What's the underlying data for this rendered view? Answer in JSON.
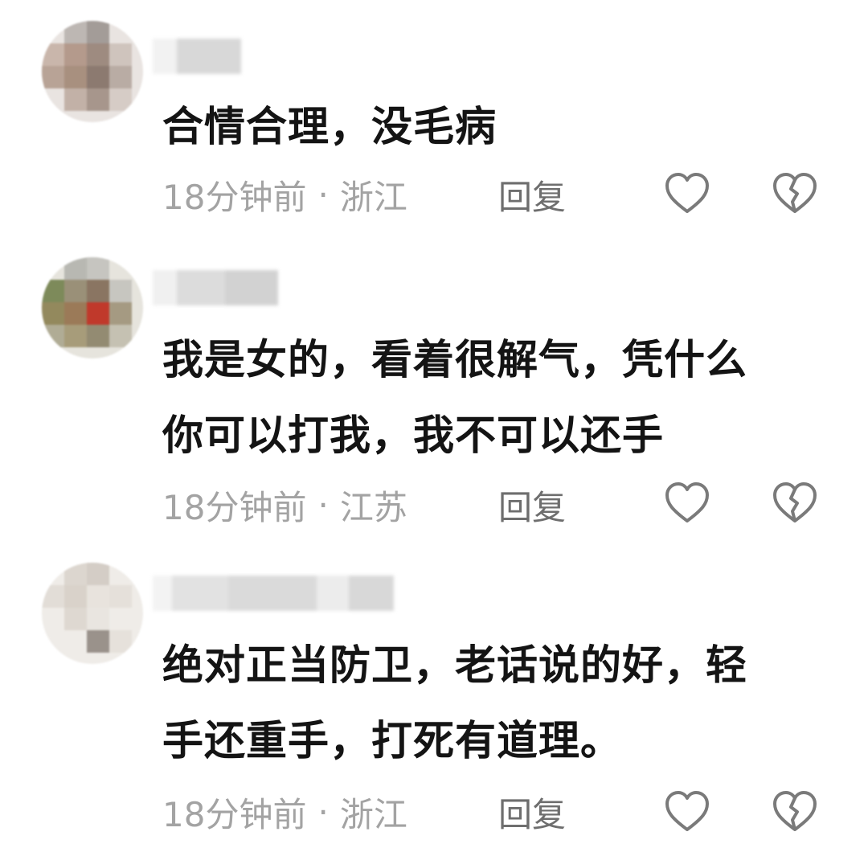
{
  "comments": [
    {
      "text": "合情合理，没毛病",
      "time": "18分钟前",
      "separator": "·",
      "location": "浙江",
      "reply_label": "回复"
    },
    {
      "text": "我是女的，看着很解气，凭什么\n你可以打我，我不可以还手",
      "time": "18分钟前",
      "separator": "·",
      "location": "江苏",
      "reply_label": "回复"
    },
    {
      "text": "绝对正当防卫，老话说的好，轻\n手还重手，打死有道理。",
      "time": "18分钟前",
      "separator": "·",
      "location": "浙江",
      "reply_label": "回复"
    }
  ],
  "icons": {
    "like": "heart-outline",
    "dislike": "broken-heart-outline"
  },
  "colors": {
    "text": "#141414",
    "meta": "#a3a3a3",
    "reply": "#6e6e6e",
    "icon": "#7a7a7a"
  }
}
